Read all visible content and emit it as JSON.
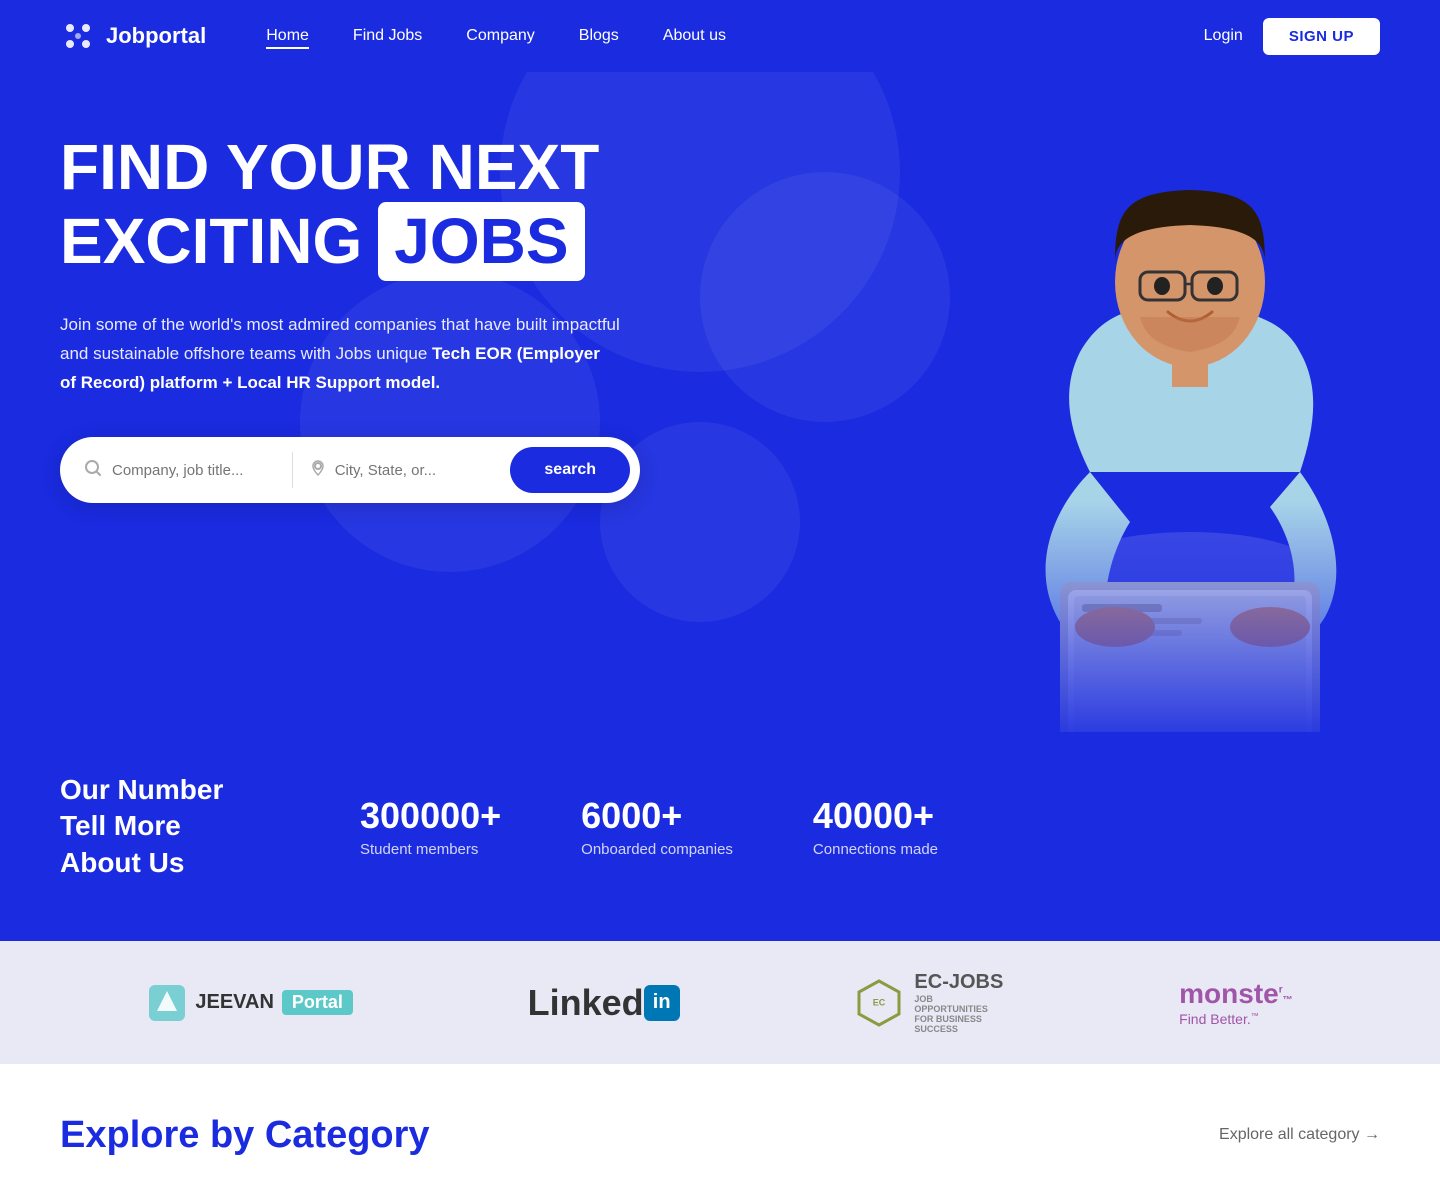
{
  "brand": {
    "name": "Jobportal"
  },
  "navbar": {
    "links": [
      {
        "label": "Home",
        "active": true
      },
      {
        "label": "Find Jobs",
        "active": false
      },
      {
        "label": "Company",
        "active": false
      },
      {
        "label": "Blogs",
        "active": false
      },
      {
        "label": "About us",
        "active": false
      }
    ],
    "login_label": "Login",
    "signup_label": "SIGN UP"
  },
  "hero": {
    "title_line1": "FIND YOUR NEXT",
    "title_line2_prefix": "EXCITING",
    "title_line2_badge": "JOBS",
    "description": "Join some of the world's most admired companies that have built impactful and sustainable offshore teams with Jobs unique ",
    "description_bold": "Tech EOR (Employer of Record) platform + Local HR Support model.",
    "search": {
      "job_placeholder": "Company, job title...",
      "location_placeholder": "City, State, or...",
      "button_label": "search"
    }
  },
  "stats": {
    "heading": "Our Number Tell More About Us",
    "items": [
      {
        "value": "300000+",
        "label": "Student members"
      },
      {
        "value": "6000+",
        "label": "Onboarded companies"
      },
      {
        "value": "40000+",
        "label": "Connections made"
      }
    ]
  },
  "partners": [
    {
      "name": "Jeevan Portal",
      "type": "jeevan"
    },
    {
      "name": "LinkedIn",
      "type": "linkedin"
    },
    {
      "name": "EC-Jobs",
      "type": "ecjobs"
    },
    {
      "name": "Monster Find Better",
      "type": "monster"
    }
  ],
  "explore": {
    "heading_prefix": "Explore by",
    "heading_highlight": "Category",
    "all_link": "Explore all category →"
  }
}
